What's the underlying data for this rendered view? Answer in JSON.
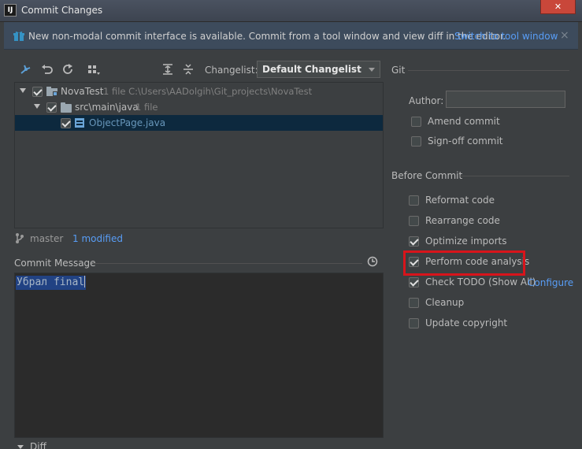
{
  "window": {
    "title": "Commit Changes",
    "icon_text": "IJ",
    "close_icon": "close-icon"
  },
  "banner": {
    "message": "New non-modal commit interface is available. Commit from a tool window and view diff in the editor.",
    "link": "Switch to tool window",
    "close": "×"
  },
  "toolbar": {
    "icons": [
      "refresh-diff-icon",
      "undo-icon",
      "reload-icon",
      "group-by-icon",
      "expand-all-icon",
      "collapse-all-icon"
    ],
    "changelist_label": "Changelist:",
    "changelist_value": "Default Changelist"
  },
  "tree": {
    "root": {
      "name": "NovaTest",
      "meta": "1 file  C:\\Users\\AADolgih\\Git_projects\\NovaTest",
      "checked": true
    },
    "folder": {
      "name": "src\\main\\java",
      "meta": "1 file",
      "checked": true
    },
    "file": {
      "name": "ObjectPage.java",
      "checked": true
    }
  },
  "status": {
    "branch": "master",
    "modified": "1 modified"
  },
  "commit_message": {
    "label": "Commit Message",
    "text": "Убрал final"
  },
  "diff": {
    "label": "Diff"
  },
  "git": {
    "label": "Git",
    "author_label": "Author:",
    "author_value": "",
    "amend": {
      "label": "Amend commit",
      "checked": false
    },
    "signoff": {
      "label": "Sign-off commit",
      "checked": false
    }
  },
  "before_commit": {
    "label": "Before Commit",
    "options": [
      {
        "label": "Reformat code",
        "checked": false
      },
      {
        "label": "Rearrange code",
        "checked": false
      },
      {
        "label": "Optimize imports",
        "checked": true
      },
      {
        "label": "Perform code analysis",
        "checked": true
      },
      {
        "label": "Check TODO (Show All)",
        "checked": true
      },
      {
        "label": "Cleanup",
        "checked": false
      },
      {
        "label": "Update copyright",
        "checked": false
      }
    ],
    "configure_link": "Configure"
  },
  "colors": {
    "accent_link": "#589df6",
    "highlight": "#d8141b",
    "selection": "#0d293e"
  }
}
